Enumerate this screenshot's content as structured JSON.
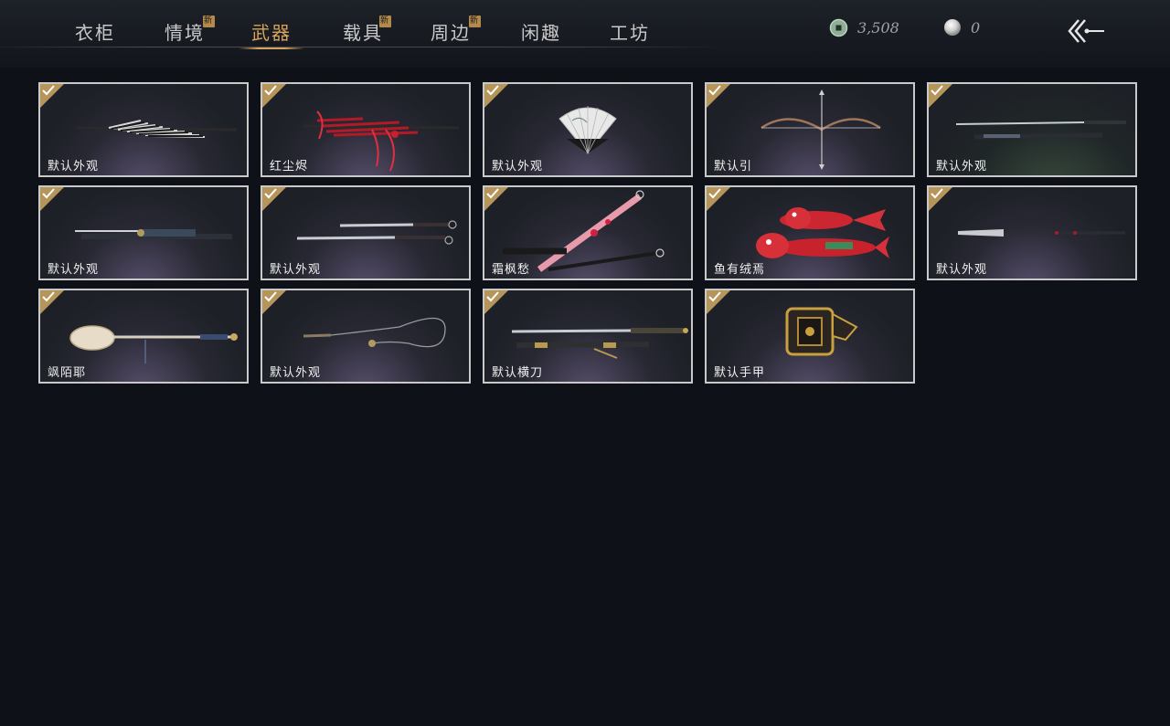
{
  "tabs": [
    {
      "label": "衣柜",
      "new": false,
      "active": false
    },
    {
      "label": "情境",
      "new": true,
      "active": false
    },
    {
      "label": "武器",
      "new": false,
      "active": true
    },
    {
      "label": "载具",
      "new": true,
      "active": false
    },
    {
      "label": "周边",
      "new": true,
      "active": false
    },
    {
      "label": "闲趣",
      "new": false,
      "active": false
    },
    {
      "label": "工坊",
      "new": false,
      "active": false
    }
  ],
  "new_badge": "新",
  "currency": {
    "coins": "3,508",
    "pearls": "0"
  },
  "items": [
    {
      "label": "默认外观",
      "icon": "umbrella-weapon-icon",
      "selected": true
    },
    {
      "label": "红尘烬",
      "icon": "red-umbrella-weapon-icon",
      "selected": true
    },
    {
      "label": "默认外观",
      "icon": "folding-fan-icon",
      "selected": true
    },
    {
      "label": "默认引",
      "icon": "bow-icon",
      "selected": true
    },
    {
      "label": "默认外观",
      "icon": "sword-pair-icon",
      "selected": true
    },
    {
      "label": "默认外观",
      "icon": "dagger-icon",
      "selected": true
    },
    {
      "label": "默认外观",
      "icon": "twin-blades-icon",
      "selected": true
    },
    {
      "label": "霜枫愁",
      "icon": "pink-twin-swords-icon",
      "selected": true
    },
    {
      "label": "鱼有绒焉",
      "icon": "koi-fish-weapon-icon",
      "selected": true
    },
    {
      "label": "默认外观",
      "icon": "spear-icon",
      "selected": true
    },
    {
      "label": "飒陌耶",
      "icon": "staff-icon",
      "selected": true
    },
    {
      "label": "默认外观",
      "icon": "rope-dart-icon",
      "selected": true
    },
    {
      "label": "默认横刀",
      "icon": "hengdao-sword-icon",
      "selected": true
    },
    {
      "label": "默认手甲",
      "icon": "gauntlet-icon",
      "selected": true
    }
  ],
  "colors": {
    "accent": "#d7a35a",
    "badge": "#b48a4c",
    "check": "#b6955a",
    "background": "#0e1218"
  }
}
